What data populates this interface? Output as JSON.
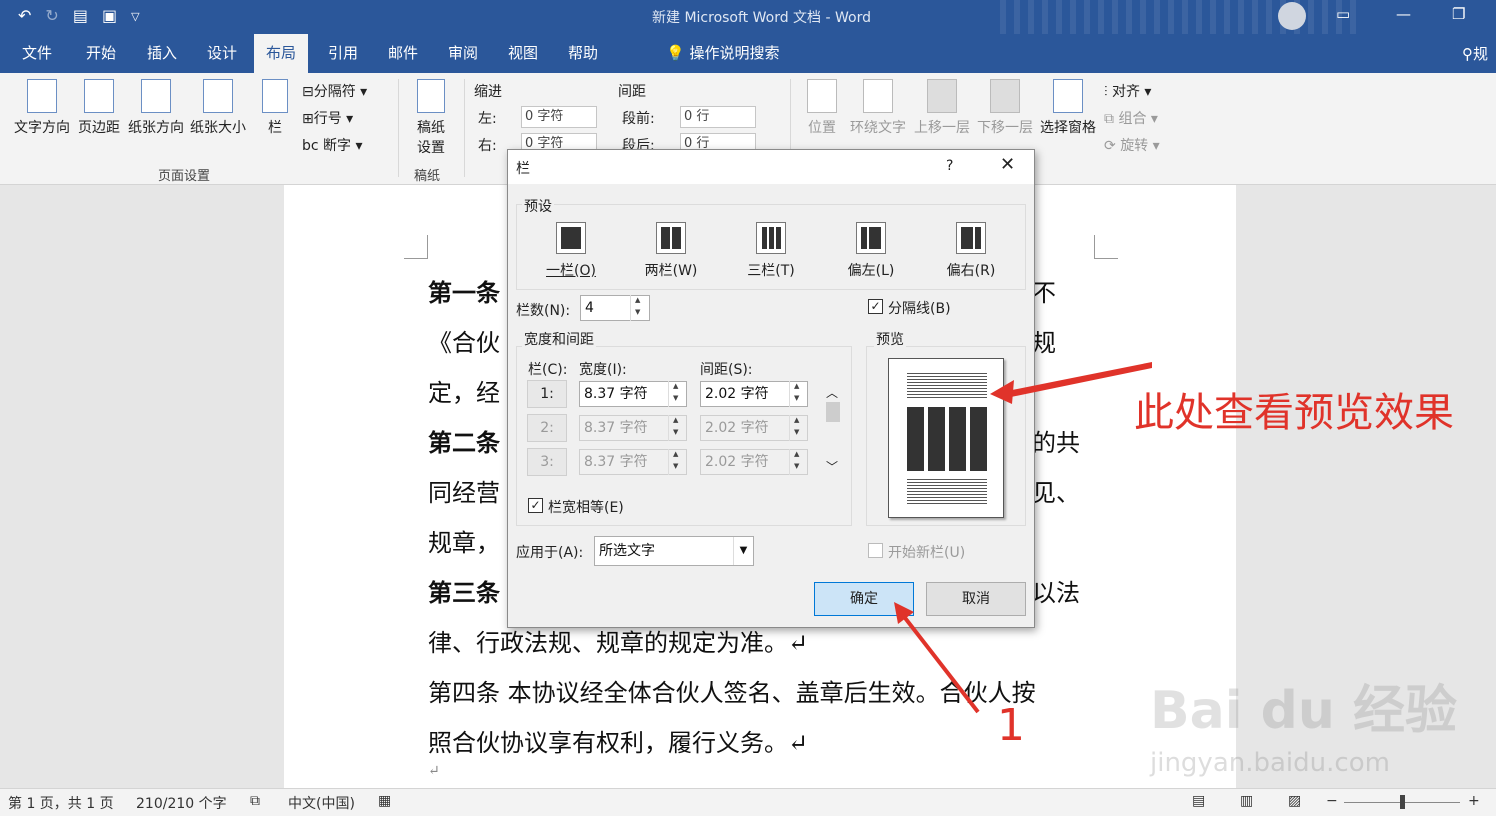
{
  "titlebar": {
    "title": "新建 Microsoft Word 文档 - Word"
  },
  "tabs": [
    "文件",
    "开始",
    "插入",
    "设计",
    "布局",
    "引用",
    "邮件",
    "审阅",
    "视图",
    "帮助"
  ],
  "tabs_active": "布局",
  "search_label": "操作说明搜索",
  "ribbon": {
    "page_setup": {
      "text_direction": "文字方向",
      "margins": "页边距",
      "orientation": "纸张方向",
      "size": "纸张大小",
      "columns": "栏",
      "breaks": "分隔符",
      "line_numbers": "行号",
      "hyphenation": "断字",
      "group_label": "页面设置"
    },
    "draft": {
      "label": "稿纸\n设置",
      "group_label": "稿纸"
    },
    "paragraph": {
      "indent_label": "缩进",
      "spacing_label": "间距",
      "left_label": "左:",
      "left_value": "0 字符",
      "right_label": "右:",
      "right_value": "0 字符",
      "before_label": "段前:",
      "before_value": "0 行",
      "after_label": "段后:",
      "after_value": "0 行"
    },
    "arrange": {
      "position": "位置",
      "wrap": "环绕文字",
      "forward": "上移一层",
      "backward": "下移一层",
      "selection_pane": "选择窗格",
      "align": "对齐",
      "group": "组合",
      "rotate": "旋转"
    }
  },
  "document": {
    "lines": [
      "第一条",
      "《合伙",
      "定，经",
      "第二条",
      "同经营",
      "规章，",
      "第三条",
      "律、行政法规、规章的规定为准。↵",
      "第四条  本协议经全体合伙人签名、盖章后生效。合伙人按",
      "照合伙协议享有权利，履行义务。↵",
      "↵"
    ],
    "right_fragments": [
      "不",
      "规",
      "的共",
      "见、",
      "以法"
    ]
  },
  "dialog": {
    "title": "栏",
    "help": "?",
    "presets_label": "预设",
    "presets": [
      "一栏(O)",
      "两栏(W)",
      "三栏(T)",
      "偏左(L)",
      "偏右(R)"
    ],
    "num_columns_label": "栏数(N):",
    "num_columns_value": "4",
    "line_between_label": "分隔线(B)",
    "line_between_checked": true,
    "width_spacing_label": "宽度和间距",
    "preview_label": "预览",
    "col_header": "栏(C):",
    "width_header": "宽度(I):",
    "spacing_header": "间距(S):",
    "rows": [
      {
        "num": "1:",
        "width": "8.37 字符",
        "spacing": "2.02 字符",
        "enabled": true
      },
      {
        "num": "2:",
        "width": "8.37 字符",
        "spacing": "2.02 字符",
        "enabled": false
      },
      {
        "num": "3:",
        "width": "8.37 字符",
        "spacing": "2.02 字符",
        "enabled": false
      }
    ],
    "equal_width_label": "栏宽相等(E)",
    "equal_width_checked": true,
    "apply_to_label": "应用于(A):",
    "apply_to_value": "所选文字",
    "start_new_column_label": "开始新栏(U)",
    "ok": "确定",
    "cancel": "取消"
  },
  "annotation": {
    "text": "此处查看预览效果",
    "marker": "1"
  },
  "watermark": {
    "logo": "Bai du 经验",
    "url": "jingyan.baidu.com"
  },
  "status": {
    "page": "第 1 页，共 1 页",
    "words": "210/210 个字",
    "language": "中文(中国)",
    "zoom_minus": "−",
    "zoom_plus": "+"
  },
  "colors": {
    "brand": "#2b579a",
    "annotation": "#e0332a",
    "ok_button": "#cce4f7"
  }
}
